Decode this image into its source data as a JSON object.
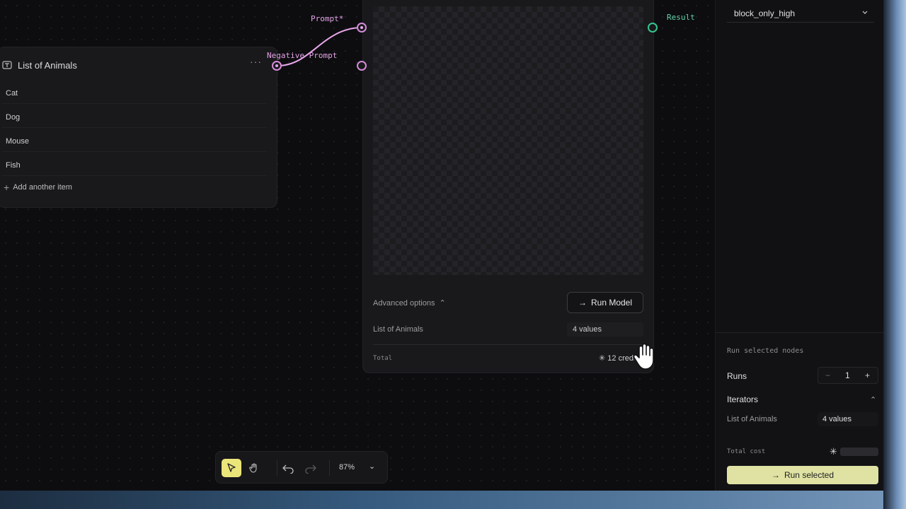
{
  "list_node": {
    "title": "List of Animals",
    "more": "···",
    "items": [
      "Cat",
      "Dog",
      "Mouse",
      "Fish"
    ],
    "add_label": "Add another item"
  },
  "ports": {
    "prompt": "Prompt*",
    "negative_prompt": "Negative Prompt",
    "result": "Result"
  },
  "model_node": {
    "advanced_options": "Advanced options",
    "run_button": "Run Model",
    "iterator_label": "List of Animals",
    "iterator_value": "4 values",
    "total_label": "Total",
    "credits": "12 credits"
  },
  "toolbar": {
    "zoom": "87%"
  },
  "right_panel": {
    "safety_select": "block_only_high",
    "run_selected_title": "Run selected nodes",
    "runs_label": "Runs",
    "runs_minus": "−",
    "runs_value": "1",
    "runs_plus": "+",
    "iterators_label": "Iterators",
    "iterator_name": "List of Animals",
    "iterator_value": "4 values",
    "total_cost_label": "Total cost",
    "run_selected_button": "Run selected"
  },
  "colors": {
    "port_pink": "#d58bd8",
    "port_green": "#35c48f",
    "accent_yellow": "#ece57a",
    "run_selected_bg": "#dfe2a3"
  }
}
